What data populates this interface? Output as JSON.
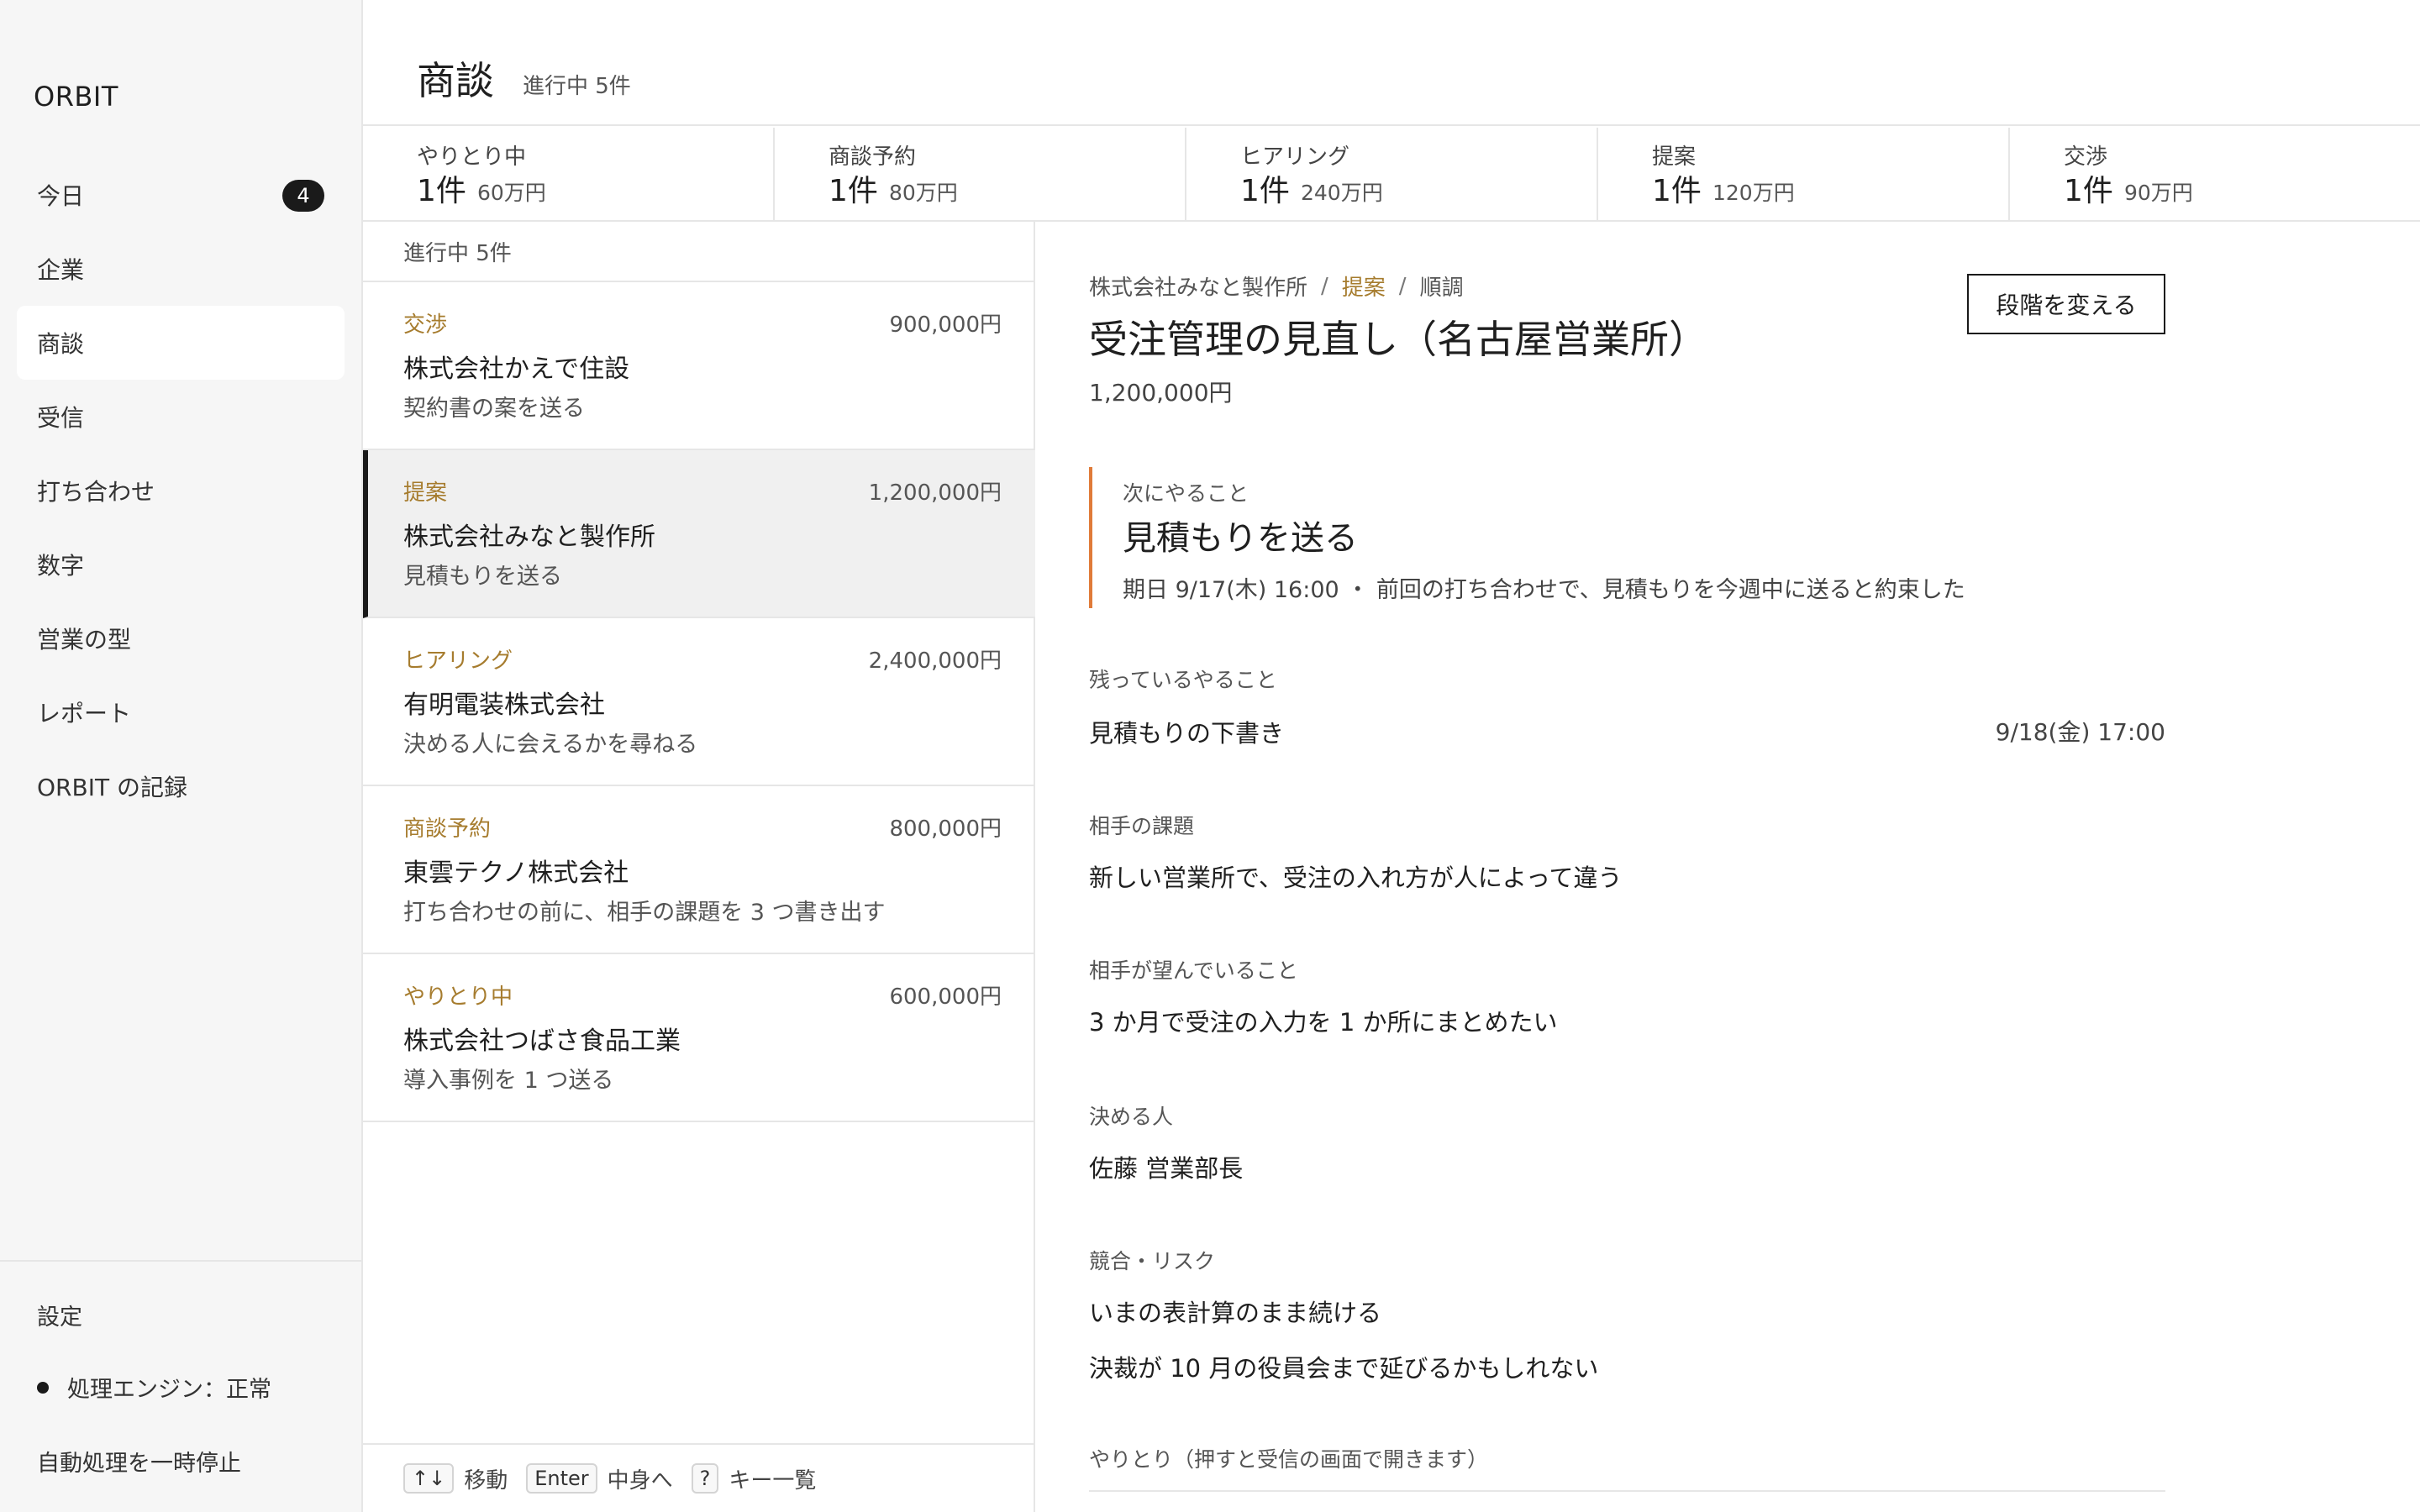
{
  "app": {
    "name": "ORBIT"
  },
  "sidebar": {
    "items": [
      {
        "label": "今日",
        "badge": "4"
      },
      {
        "label": "企業"
      },
      {
        "label": "商談",
        "active": true
      },
      {
        "label": "受信"
      },
      {
        "label": "打ち合わせ"
      },
      {
        "label": "数字"
      },
      {
        "label": "営業の型"
      },
      {
        "label": "レポート"
      },
      {
        "label": "ORBIT の記録"
      }
    ],
    "settings_label": "設定",
    "engine_status": "処理エンジン：正常",
    "pause_label": "自動処理を一時停止"
  },
  "header": {
    "title": "商談",
    "subtitle": "進行中 5件"
  },
  "stages": [
    {
      "label": "やりとり中",
      "count": "1件",
      "amount": "60万円"
    },
    {
      "label": "商談予約",
      "count": "1件",
      "amount": "80万円"
    },
    {
      "label": "ヒアリング",
      "count": "1件",
      "amount": "240万円"
    },
    {
      "label": "提案",
      "count": "1件",
      "amount": "120万円"
    },
    {
      "label": "交渉",
      "count": "1件",
      "amount": "90万円"
    }
  ],
  "list": {
    "header": "進行中  5件",
    "deals": [
      {
        "stage": "交渉",
        "amount": "900,000円",
        "company": "株式会社かえで住設",
        "next": "契約書の案を送る"
      },
      {
        "stage": "提案",
        "amount": "1,200,000円",
        "company": "株式会社みなと製作所",
        "next": "見積もりを送る",
        "selected": true
      },
      {
        "stage": "ヒアリング",
        "amount": "2,400,000円",
        "company": "有明電装株式会社",
        "next": "決める人に会えるかを尋ねる"
      },
      {
        "stage": "商談予約",
        "amount": "800,000円",
        "company": "東雲テクノ株式会社",
        "next": "打ち合わせの前に、相手の課題を 3 つ書き出す"
      },
      {
        "stage": "やりとり中",
        "amount": "600,000円",
        "company": "株式会社つばさ食品工業",
        "next": "導入事例を 1 つ送る"
      }
    ],
    "hints": [
      {
        "key": "↑↓",
        "label": "移動"
      },
      {
        "key": "Enter",
        "label": "中身へ"
      },
      {
        "key": "?",
        "label": "キー一覧"
      }
    ]
  },
  "detail": {
    "breadcrumb": {
      "company": "株式会社みなと製作所",
      "stage": "提案",
      "status": "順調",
      "sep": "/"
    },
    "title": "受注管理の見直し（名古屋営業所）",
    "amount": "1,200,000円",
    "change_stage_button": "段階を変える",
    "next_action": {
      "label": "次にやること",
      "title": "見積もりを送る",
      "meta": "期日 9/17(木) 16:00 ・ 前回の打ち合わせで、見積もりを今週中に送ると約束した"
    },
    "remaining": {
      "label": "残っているやること",
      "task": "見積もりの下書き",
      "date": "9/18(金) 17:00"
    },
    "problem": {
      "label": "相手の課題",
      "text": "新しい営業所で、受注の入れ方が人によって違う"
    },
    "wants": {
      "label": "相手が望んでいること",
      "text": "3 か月で受注の入力を 1 か所にまとめたい"
    },
    "decision_maker": {
      "label": "決める人",
      "text": "佐藤 営業部長"
    },
    "risks": {
      "label": "競合・リスク",
      "items": [
        "いまの表計算のまま続ける",
        "決裁が 10 月の役員会まで延びるかもしれない"
      ]
    },
    "activity": {
      "label": "やりとり（押すと受信の画面で開きます）"
    }
  },
  "colors": {
    "stage_text": "#a67c2e",
    "accent_border": "#e07b39",
    "selected_border": "#1a1a1a",
    "sidebar_bg": "#f6f6f6"
  }
}
